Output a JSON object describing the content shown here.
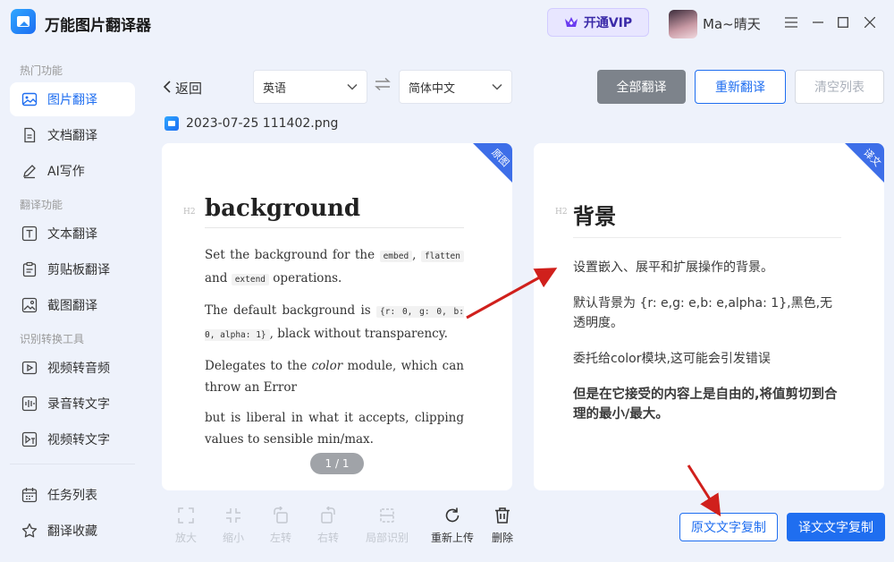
{
  "app": {
    "title": "万能图片翻译器"
  },
  "header": {
    "vip_label": "开通VIP",
    "username": "Ma~晴天"
  },
  "sidebar": {
    "sections": [
      {
        "title": "热门功能"
      },
      {
        "title": "翻译功能"
      },
      {
        "title": "识别转换工具"
      }
    ],
    "items": [
      {
        "label": "图片翻译",
        "icon": "image-icon",
        "active": true
      },
      {
        "label": "文档翻译",
        "icon": "document-icon"
      },
      {
        "label": "AI写作",
        "icon": "pen-icon"
      },
      {
        "label": "文本翻译",
        "icon": "text-icon"
      },
      {
        "label": "剪贴板翻译",
        "icon": "clipboard-icon"
      },
      {
        "label": "截图翻译",
        "icon": "screenshot-icon"
      },
      {
        "label": "视频转音频",
        "icon": "video-audio-icon"
      },
      {
        "label": "录音转文字",
        "icon": "record-icon"
      },
      {
        "label": "视频转文字",
        "icon": "video-text-icon"
      },
      {
        "label": "任务列表",
        "icon": "calendar-icon"
      },
      {
        "label": "翻译收藏",
        "icon": "star-icon"
      }
    ]
  },
  "toolbar": {
    "back_label": "返回",
    "source_lang": "英语",
    "target_lang": "简体中文",
    "translate_all": "全部翻译",
    "retranslate": "重新翻译",
    "clear_list": "清空列表"
  },
  "file": {
    "name": "2023-07-25 111402.png"
  },
  "original": {
    "corner_label": "原图",
    "heading_tag": "H2",
    "title": "background",
    "p1_pre": "Set the background for the ",
    "p1_code1": "embed",
    "p1_sep": ", ",
    "p1_code2": "flatten",
    "p1_and": " and ",
    "p1_code3": "extend",
    "p1_post": " operations.",
    "p2_pre": "The default background is ",
    "p2_code": "{r: 0, g: 0, b: 0, alpha: 1}",
    "p2_post": ", black without transparency.",
    "p3_pre": "Delegates to the ",
    "p3_em": "color",
    "p3_post": " module, which can throw an Error",
    "p4": "but is liberal in what it accepts, clipping values to sensible min/max.",
    "pager": "1 / 1"
  },
  "translation": {
    "corner_label": "译文",
    "heading_tag": "H2",
    "title": "背景",
    "p1": "设置嵌入、展平和扩展操作的背景。",
    "p2": "默认背景为 {r: e,g: e,b: e,alpha: 1},黑色,无透明度。",
    "p3": "委托给color模块,这可能会引发错误",
    "p4": "但是在它接受的内容上是自由的,将值剪切到合理的最小/最大。"
  },
  "bottom_tools": {
    "zoom_in": "放大",
    "zoom_out": "缩小",
    "rotate_left": "左转",
    "rotate_right": "右转",
    "partial_ocr": "局部识别",
    "reupload": "重新上传",
    "delete": "删除"
  },
  "copy_buttons": {
    "copy_original": "原文文字复制",
    "copy_translation": "译文文字复制"
  },
  "colors": {
    "accent": "#1f6ef0",
    "annotation_arrow": "#d0201c",
    "corner_tag": "#3d6ee8"
  }
}
